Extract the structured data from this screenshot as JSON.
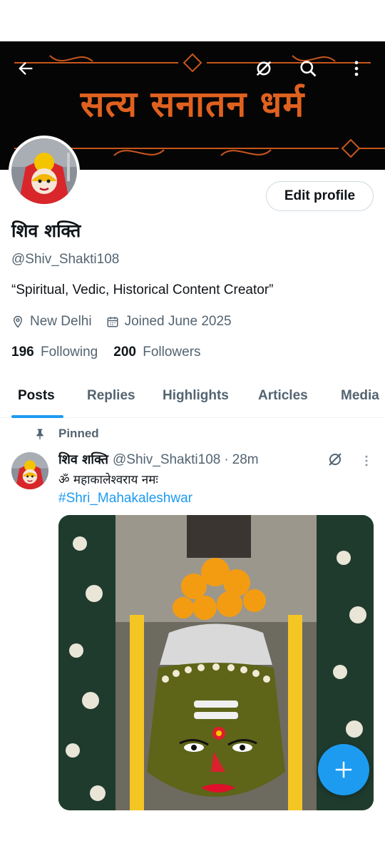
{
  "banner": {
    "text": "सत्य सनातन धर्म",
    "text_color": "#e0611f",
    "background": "#050505"
  },
  "toolbar": {
    "back_icon": "arrow-left-icon",
    "grok_icon": "grok-icon",
    "search_icon": "search-icon",
    "more_icon": "more-vertical-icon"
  },
  "profile": {
    "edit_label": "Edit profile",
    "name": "शिव शक्ति",
    "handle": "@Shiv_Shakti108",
    "bio": "“Spiritual, Vedic, Historical Content Creator”",
    "location": "New Delhi",
    "joined": "Joined June 2025",
    "following_count": "196",
    "following_label": "Following",
    "followers_count": "200",
    "followers_label": "Followers"
  },
  "tabs": [
    {
      "label": "Posts",
      "active": true
    },
    {
      "label": "Replies",
      "active": false
    },
    {
      "label": "Highlights",
      "active": false
    },
    {
      "label": "Articles",
      "active": false
    },
    {
      "label": "Media",
      "active": false
    }
  ],
  "post": {
    "pinned_label": "Pinned",
    "author_name": "शिव शक्ति",
    "author_handle": "@Shiv_Shakti108",
    "separator": "·",
    "time": "28m",
    "text": "ॐ महाकालेश्वराय नमः",
    "hashtag": "#Shri_Mahakaleshwar"
  },
  "fab": {
    "icon": "plus-icon"
  },
  "colors": {
    "accent": "#1d9bf0",
    "secondary_text": "#536471",
    "primary_text": "#0f1419"
  }
}
